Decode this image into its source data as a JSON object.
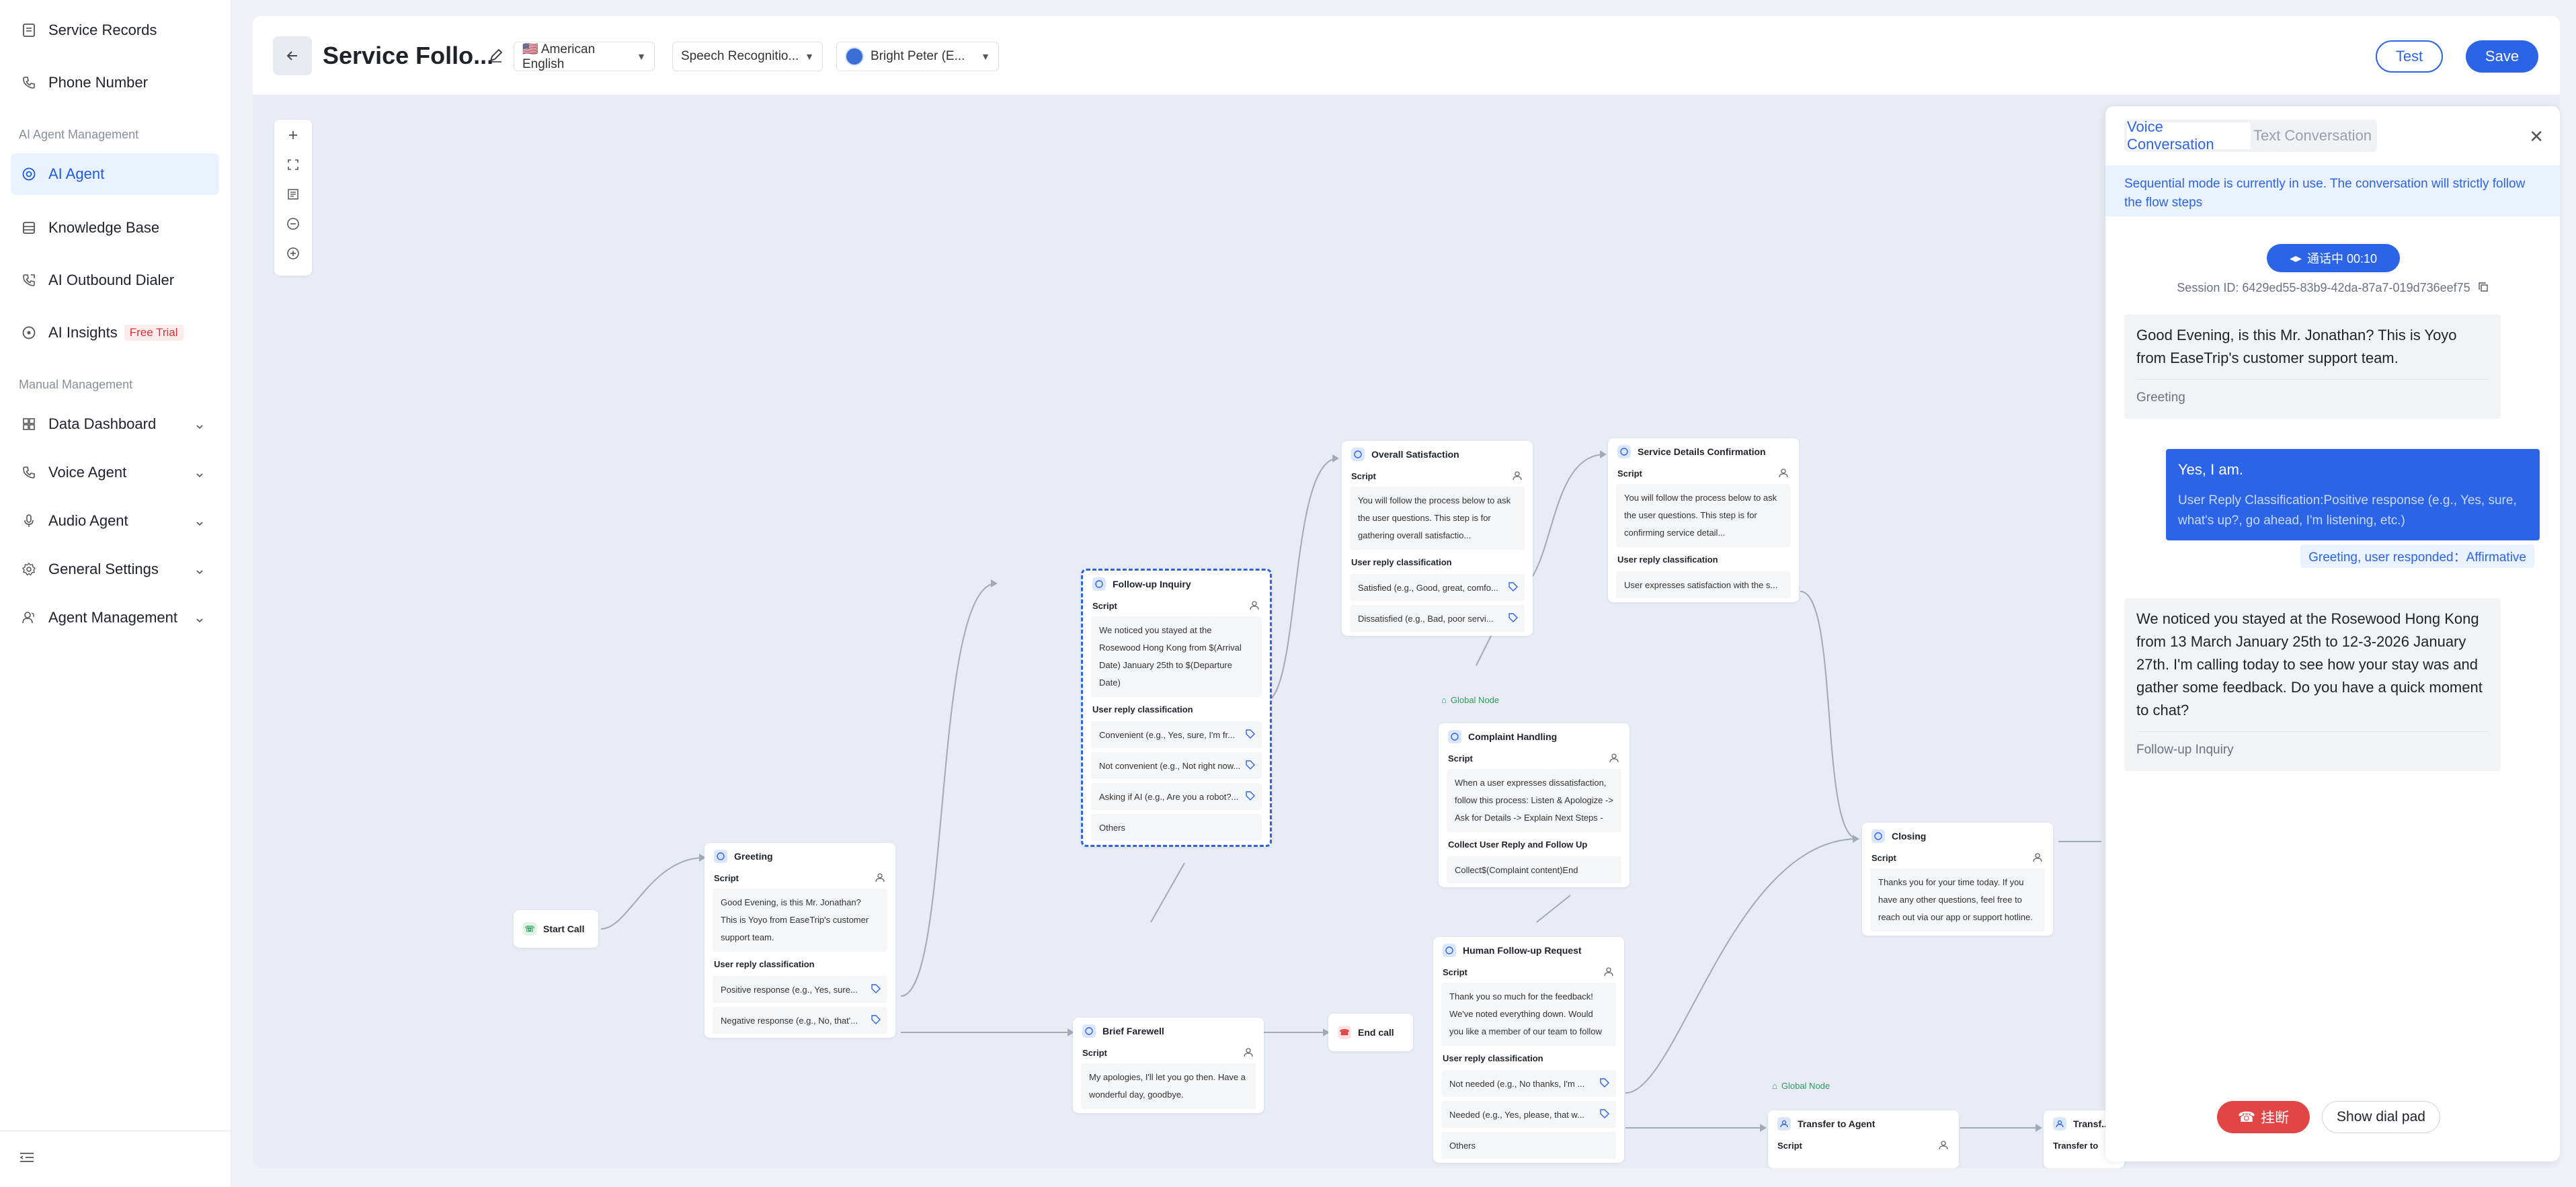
{
  "sidebar": {
    "items_top": [
      {
        "label": "Service Records",
        "icon": "document-icon"
      },
      {
        "label": "Phone Number",
        "icon": "phone-icon"
      }
    ],
    "section_ai": "AI Agent Management",
    "ai_items": [
      {
        "label": "AI Agent",
        "icon": "target-icon",
        "active": true
      },
      {
        "label": "Knowledge Base",
        "icon": "database-icon"
      },
      {
        "label": "AI Outbound Dialer",
        "icon": "outbound-call-icon"
      },
      {
        "label": "AI Insights",
        "icon": "insights-icon",
        "badge": "Free Trial"
      }
    ],
    "section_manual": "Manual Management",
    "manual_items": [
      {
        "label": "Data Dashboard",
        "icon": "grid-icon"
      },
      {
        "label": "Voice Agent",
        "icon": "phone-icon"
      },
      {
        "label": "Audio Agent",
        "icon": "microphone-icon"
      },
      {
        "label": "General Settings",
        "icon": "gear-icon"
      },
      {
        "label": "Agent Management",
        "icon": "users-icon"
      }
    ]
  },
  "header": {
    "title": "Service Follo...",
    "language": "🇺🇸 American English",
    "speech": "Speech Recognitio...",
    "voice": "Bright Peter (E...",
    "test_label": "Test",
    "save_label": "Save"
  },
  "flow": {
    "start": "Start Call",
    "end": "End call",
    "global_node": "Global Node",
    "script_label": "Script",
    "reply_label": "User reply classification",
    "greeting": {
      "title": "Greeting",
      "script": "Good Evening, is this Mr. Jonathan? This is Yoyo from EaseTrip's customer support team.",
      "options": [
        "Positive response (e.g., Yes, sure...",
        "Negative response (e.g., No, that'..."
      ]
    },
    "followup": {
      "title": "Follow-up Inquiry",
      "script": "We noticed you stayed at the Rosewood Hong Kong from $(Arrival Date) January 25th to $(Departure Date)",
      "options": [
        "Convenient (e.g., Yes, sure, I'm fr...",
        "Not convenient (e.g., Not right now...",
        "Asking if AI (e.g., Are you a robot?...",
        "Others"
      ]
    },
    "satisfaction": {
      "title": "Overall Satisfaction",
      "script": "You will follow the process below to ask the user questions. This step is for gathering overall satisfactio...",
      "options": [
        "Satisfied (e.g., Good, great, comfo...",
        "Dissatisfied (e.g., Bad, poor servi..."
      ]
    },
    "service_details": {
      "title": "Service Details Confirmation",
      "script": "You will follow the process below to ask the user questions. This step is for confirming service detail...",
      "options": [
        "User expresses satisfaction with the s..."
      ]
    },
    "complaint": {
      "title": "Complaint Handling",
      "script": "When a user expresses dissatisfaction, follow this process: Listen & Apologize -> Ask for Details -> Explain Next Steps -",
      "collect_label": "Collect User Reply and Follow Up",
      "collect": "Collect$(Complaint content)End"
    },
    "brief_farewell": {
      "title": "Brief Farewell",
      "script": "My apologies, I'll let you go then. Have a wonderful day, goodbye."
    },
    "human_followup": {
      "title": "Human Follow-up Request",
      "script": "Thank you so much for the feedback! We've noted everything down. Would you like a member of our team to follow",
      "options": [
        "Not needed (e.g., No thanks, I'm ...",
        "Needed (e.g., Yes, please, that w...",
        "Others"
      ]
    },
    "closing": {
      "title": "Closing",
      "script": "Thanks you for your time today. If you have any other questions, feel free to reach out via our app or support hotline."
    },
    "transfer": {
      "title": "Transfer to Agent"
    },
    "transfer2": {
      "title": "Transf...",
      "sub": "Transfer to"
    }
  },
  "test_panel": {
    "tab_voice": "Voice Conversation",
    "tab_text": "Text Conversation",
    "notice": "Sequential mode is currently in use. The conversation will strictly follow the flow steps",
    "call_status": "通话中  00:10",
    "session_label": "Session ID:",
    "session_id": "6429ed55-83b9-42da-87a7-019d736eef75",
    "messages": [
      {
        "text": "Good Evening, is this Mr. Jonathan? This is Yoyo from EaseTrip's customer support team.",
        "meta": "Greeting"
      },
      {
        "text": "Yes, I am.",
        "meta": "User Reply Classification:Positive response (e.g., Yes, sure, what's up?, go ahead, I'm listening, etc.)"
      },
      {
        "text": "We noticed you stayed at the Rosewood Hong Kong from 13 March January 25th to 12-3-2026 January 27th. I'm calling today to see how your stay was and gather some feedback. Do you have a quick moment to chat?",
        "meta": "Follow-up Inquiry"
      }
    ],
    "response_tag": "Greeting, user responded：Affirmative",
    "hangup_label": "挂断",
    "dialpad_label": "Show dial pad"
  }
}
